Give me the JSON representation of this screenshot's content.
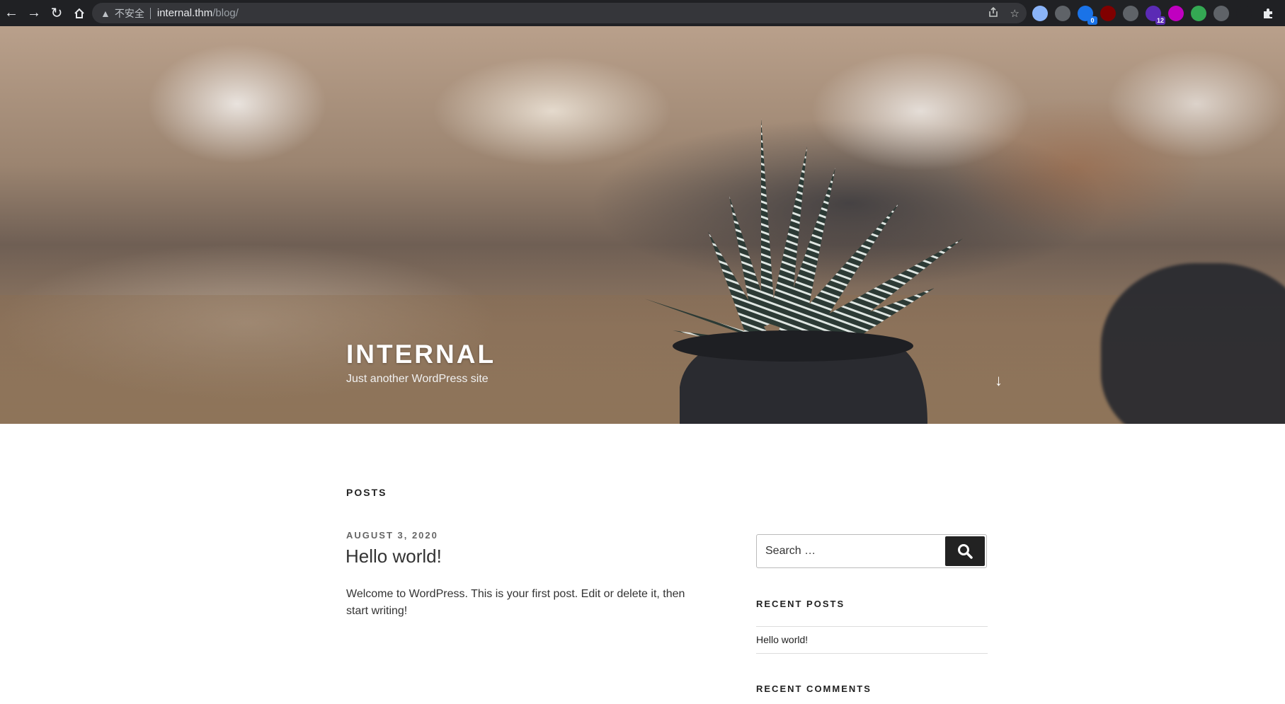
{
  "browser": {
    "insecure_label": "不安全",
    "url_host": "internal.thm",
    "url_path": "/blog/",
    "extensions": [
      {
        "icon": "circle-ext-icon",
        "color": "#8ab4f8",
        "badge": ""
      },
      {
        "icon": "glasses-ext-icon",
        "color": "#5f6368",
        "badge": ""
      },
      {
        "icon": "shield-ext-icon",
        "color": "#1a73e8",
        "badge": "0"
      },
      {
        "icon": "ublock-ext-icon",
        "color": "#800000",
        "badge": ""
      },
      {
        "icon": "cloud-ext-icon",
        "color": "#5f6368",
        "badge": ""
      },
      {
        "icon": "puzzle-purple-ext-icon",
        "color": "#5b2bb5",
        "badge": "12"
      },
      {
        "icon": "lr-ext-icon",
        "color": "#c000c0",
        "badge": ""
      },
      {
        "icon": "green-ring-ext-icon",
        "color": "#34a853",
        "badge": ""
      },
      {
        "icon": "grey-puzzle-ext-icon",
        "color": "#5f6368",
        "badge": ""
      },
      {
        "icon": "mask-ext-icon",
        "color": "#202124",
        "badge": ""
      }
    ]
  },
  "hero": {
    "site_title": "INTERNAL",
    "site_description": "Just another WordPress site"
  },
  "main": {
    "posts_heading": "POSTS",
    "post": {
      "date": "AUGUST 3, 2020",
      "title": "Hello world!",
      "excerpt": "Welcome to WordPress. This is your first post. Edit or delete it, then start writing!"
    }
  },
  "sidebar": {
    "search_placeholder": "Search …",
    "recent_posts_title": "RECENT POSTS",
    "recent_posts": [
      "Hello world!"
    ],
    "recent_comments_title": "RECENT COMMENTS"
  }
}
